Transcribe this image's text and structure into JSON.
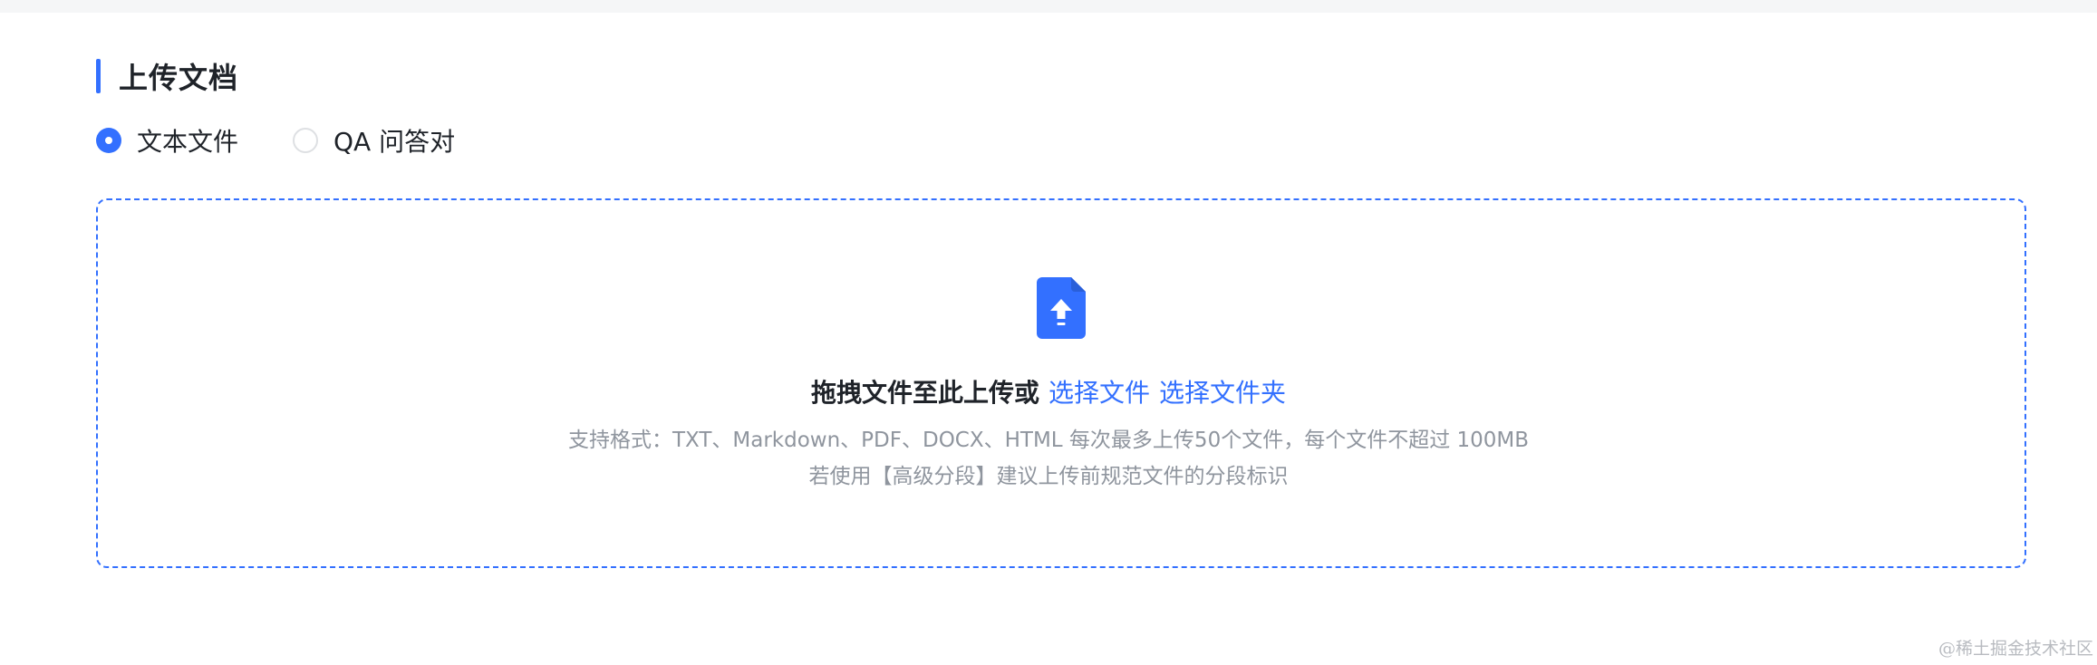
{
  "section": {
    "title": "上传文档"
  },
  "radio_group": {
    "options": [
      {
        "label": "文本文件",
        "checked": true
      },
      {
        "label": "QA 问答对",
        "checked": false
      }
    ]
  },
  "dropzone": {
    "icon": "file-upload-icon",
    "prompt": "拖拽文件至此上传或",
    "select_file_link": "选择文件",
    "select_folder_link": "选择文件夹",
    "hint_formats": "支持格式：TXT、Markdown、PDF、DOCX、HTML 每次最多上传50个文件，每个文件不超过 100MB",
    "hint_segment": "若使用【高级分段】建议上传前规范文件的分段标识"
  },
  "watermark": "@稀土掘金技术社区",
  "colors": {
    "accent": "#3370ff",
    "text_primary": "#1f2329",
    "text_secondary": "#8f959e",
    "radio_border": "#dee0e3"
  }
}
